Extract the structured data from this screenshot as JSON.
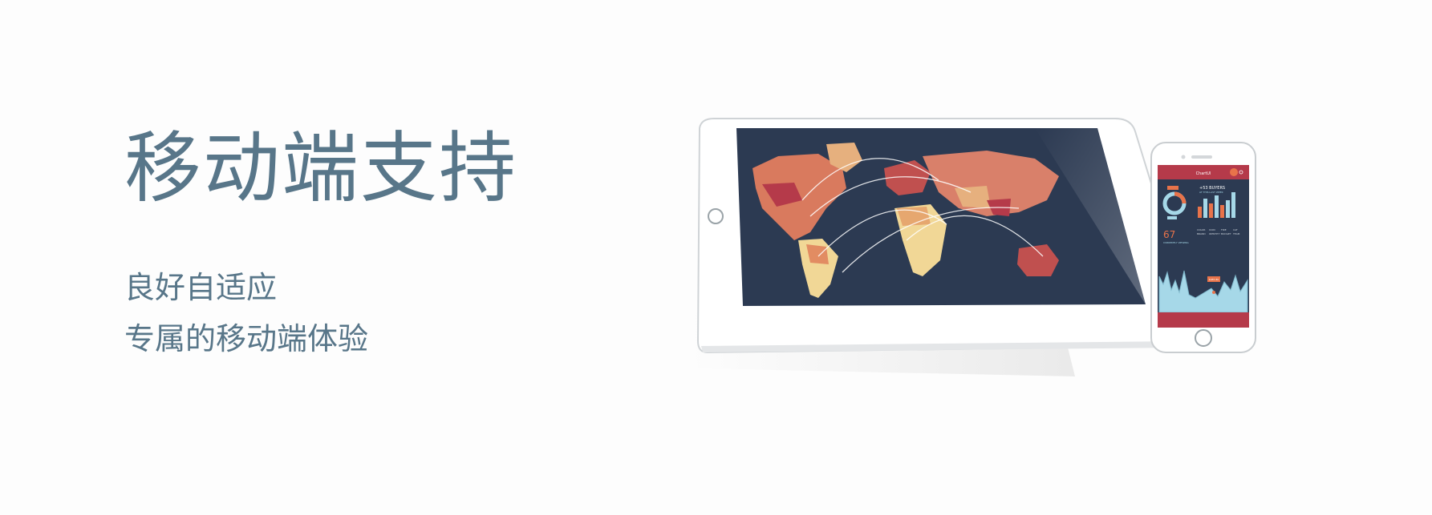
{
  "hero": {
    "title": "移动端支持",
    "subtitle_1": "良好自适应",
    "subtitle_2": "专属的移动端体验"
  },
  "phone": {
    "brand": "ChartUI",
    "buyers_label": "+53 BUYERS",
    "buyers_sub": "AT THIS LAST WEEK",
    "big_number": "67",
    "big_number_label": "CURRENTLY VIEWING",
    "col_labels": [
      "COLOR",
      "ICON",
      "FIRE",
      "CAT"
    ],
    "col_sub": [
      "BRAND",
      "IDENTITY",
      "BUDGET",
      "TEAM"
    ],
    "tooltip": "$987.80"
  },
  "colors": {
    "text": "#587689",
    "map_bg": "#2c3a52",
    "accent_red": "#b53a4a",
    "accent_orange": "#e8734a",
    "chart_blue": "#a6d8e8"
  }
}
